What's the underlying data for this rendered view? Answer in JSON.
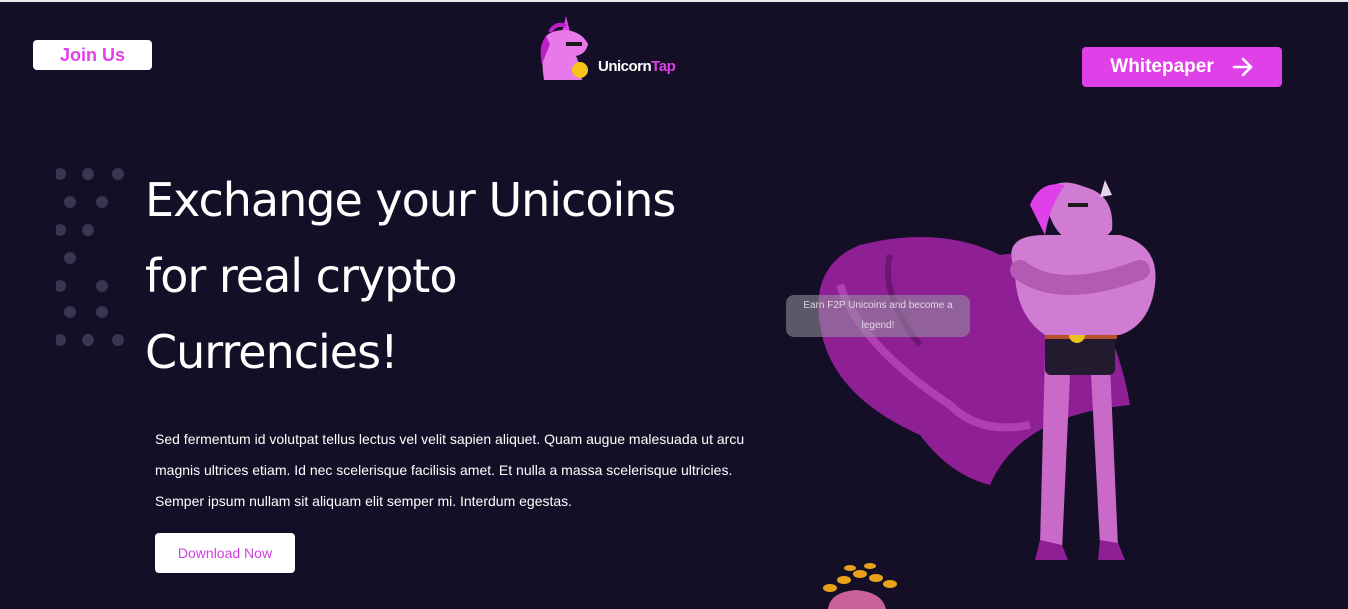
{
  "header": {
    "join_label": "Join Us",
    "logo_text_white": "Unicorn",
    "logo_text_pink": "Tap",
    "whitepaper_label": "Whitepaper",
    "whitepaper_icon": "arrow-right-icon"
  },
  "hero": {
    "headline_lines": [
      "Exchange your Unicoins",
      "for real crypto",
      "Currencies!"
    ],
    "paragraph": "Sed fermentum id volutpat tellus lectus vel velit sapien aliquet. Quam augue malesuada ut arcu magnis ultrices etiam. Id nec scelerisque facilisis amet. Et nulla a massa scelerisque ultricies. Semper ipsum nullam sit aliquam elit semper mi. Interdum egestas.",
    "download_label": "Download Now",
    "tooltip_text": "Earn F2P Unicoins and become a legend!"
  },
  "colors": {
    "background": "#140f26",
    "accent": "#e040e8",
    "white": "#ffffff"
  }
}
